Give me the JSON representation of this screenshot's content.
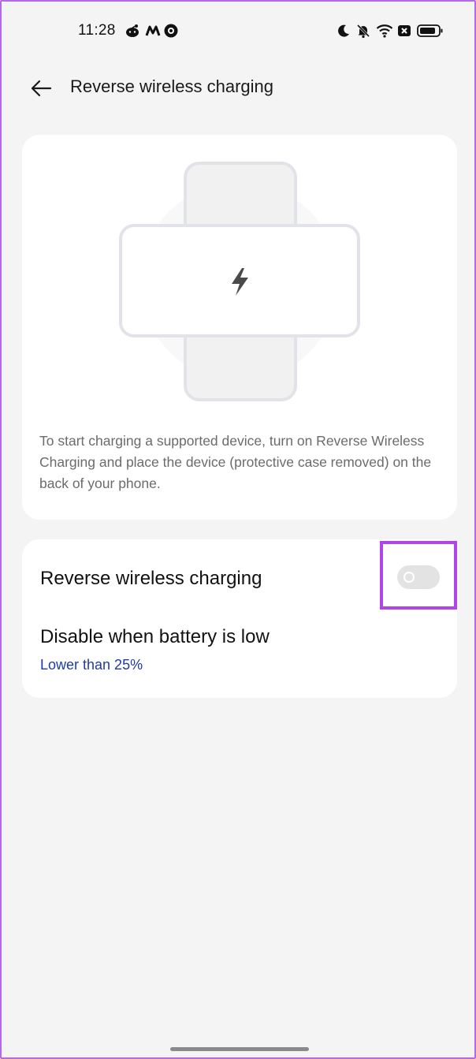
{
  "status_bar": {
    "time": "11:28",
    "left_icons": [
      "reddit-icon",
      "myntra-icon",
      "circle-app-icon"
    ],
    "right_icons": [
      "moon-icon",
      "bell-off-icon",
      "wifi-icon",
      "sim-off-icon",
      "battery-icon"
    ]
  },
  "header": {
    "title": "Reverse wireless charging",
    "back_icon": "arrow-left-icon"
  },
  "illustration": {
    "icon": "lightning-bolt-icon",
    "description": "To start charging a supported device, turn on Reverse Wireless Charging and place the device (protective case removed) on the back of your phone."
  },
  "settings": {
    "reverse_charging": {
      "label": "Reverse wireless charging",
      "enabled": false
    },
    "disable_low_battery": {
      "label": "Disable when battery is low",
      "value": "Lower than 25%"
    }
  },
  "colors": {
    "background": "#f4f4f4",
    "card": "#ffffff",
    "accent_link": "#1f3aa8",
    "highlight": "#b046e8",
    "toggle_off": "#e3e3e3"
  }
}
